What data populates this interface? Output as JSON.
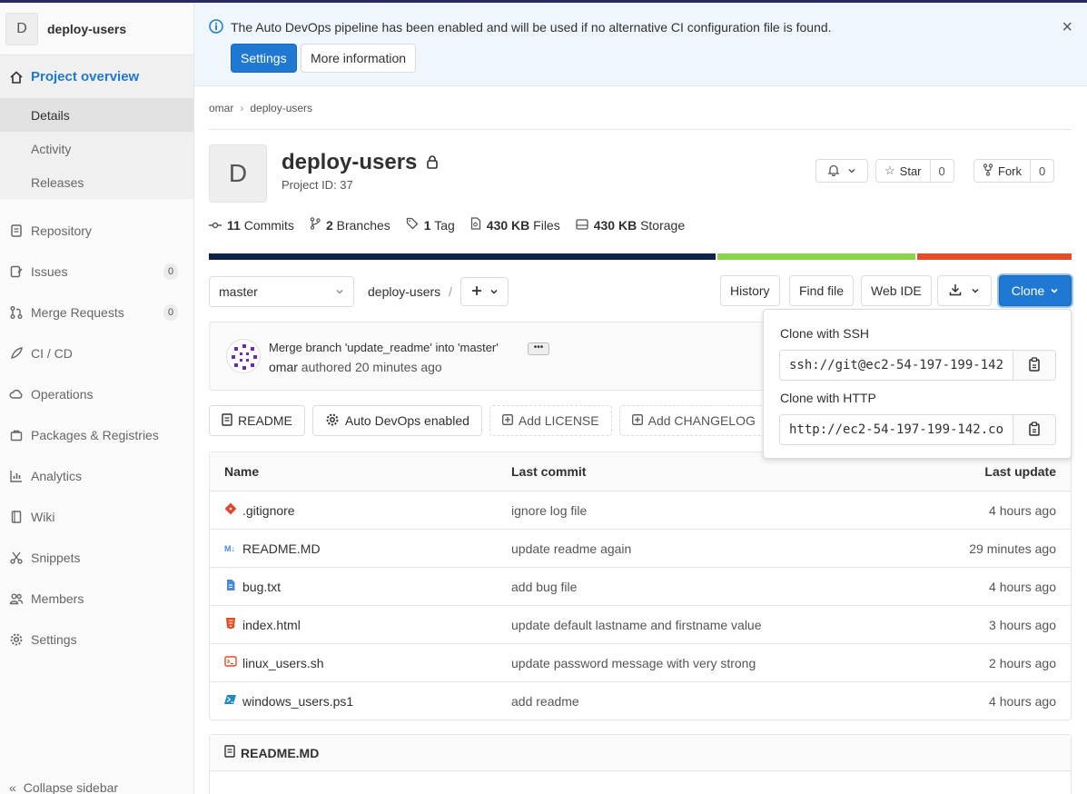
{
  "sidebar": {
    "project_initial": "D",
    "project_name": "deploy-users",
    "overview": "Project overview",
    "sub_items": [
      "Details",
      "Activity",
      "Releases"
    ],
    "items": [
      {
        "label": "Repository"
      },
      {
        "label": "Issues",
        "count": "0"
      },
      {
        "label": "Merge Requests",
        "count": "0"
      },
      {
        "label": "CI / CD"
      },
      {
        "label": "Operations"
      },
      {
        "label": "Packages & Registries"
      },
      {
        "label": "Analytics"
      },
      {
        "label": "Wiki"
      },
      {
        "label": "Snippets"
      },
      {
        "label": "Members"
      },
      {
        "label": "Settings"
      }
    ],
    "collapse": "Collapse sidebar"
  },
  "banner": {
    "message": "The Auto DevOps pipeline has been enabled and will be used if no alternative CI configuration file is found.",
    "settings_btn": "Settings",
    "more_info_btn": "More information",
    "close": "×"
  },
  "breadcrumb": {
    "owner": "omar",
    "project": "deploy-users"
  },
  "project": {
    "initial": "D",
    "title": "deploy-users",
    "project_id": "Project ID: 37",
    "star_label": "Star",
    "star_count": "0",
    "fork_label": "Fork",
    "fork_count": "0"
  },
  "stats": {
    "commits_n": "11",
    "commits_l": "Commits",
    "branches_n": "2",
    "branches_l": "Branches",
    "tags_n": "1",
    "tags_l": "Tag",
    "files_n": "430 KB",
    "files_l": "Files",
    "storage_n": "430 KB",
    "storage_l": "Storage"
  },
  "language_bar": [
    {
      "color": "#0c2448",
      "share": 0.59
    },
    {
      "color": "#8ad44c",
      "share": 0.23
    },
    {
      "color": "#e44d26",
      "share": 0.18
    }
  ],
  "toolbar": {
    "branch": "master",
    "path": "deploy-users",
    "slash": "/",
    "history": "History",
    "find_file": "Find file",
    "web_ide": "Web IDE",
    "clone": "Clone"
  },
  "commit": {
    "title": "Merge branch 'update_readme' into 'master'",
    "author": "omar",
    "authored": "authored",
    "time": "20 minutes ago"
  },
  "quick_links": {
    "readme": "README",
    "autodevops": "Auto DevOps enabled",
    "license": "Add LICENSE",
    "changelog": "Add CHANGELOG"
  },
  "files": {
    "headers": {
      "name": "Name",
      "last_commit": "Last commit",
      "last_update": "Last update"
    },
    "rows": [
      {
        "name": ".gitignore",
        "commit": "ignore log file",
        "updated": "4 hours ago",
        "icon": "git-icon"
      },
      {
        "name": "README.MD",
        "commit": "update readme again",
        "updated": "29 minutes ago",
        "icon": "markdown-icon"
      },
      {
        "name": "bug.txt",
        "commit": "add bug file",
        "updated": "4 hours ago",
        "icon": "text-file-icon"
      },
      {
        "name": "index.html",
        "commit": "update default lastname and firstname value",
        "updated": "3 hours ago",
        "icon": "html-icon"
      },
      {
        "name": "linux_users.sh",
        "commit": "update password message with very strong",
        "updated": "2 hours ago",
        "icon": "shell-icon"
      },
      {
        "name": "windows_users.ps1",
        "commit": "add readme",
        "updated": "4 hours ago",
        "icon": "powershell-icon"
      }
    ]
  },
  "readme_title": "README.MD",
  "clone_dropdown": {
    "ssh_label": "Clone with SSH",
    "ssh_url": "ssh://git@ec2-54-197-199-142",
    "http_label": "Clone with HTTP",
    "http_url": "http://ec2-54-197-199-142.co"
  }
}
